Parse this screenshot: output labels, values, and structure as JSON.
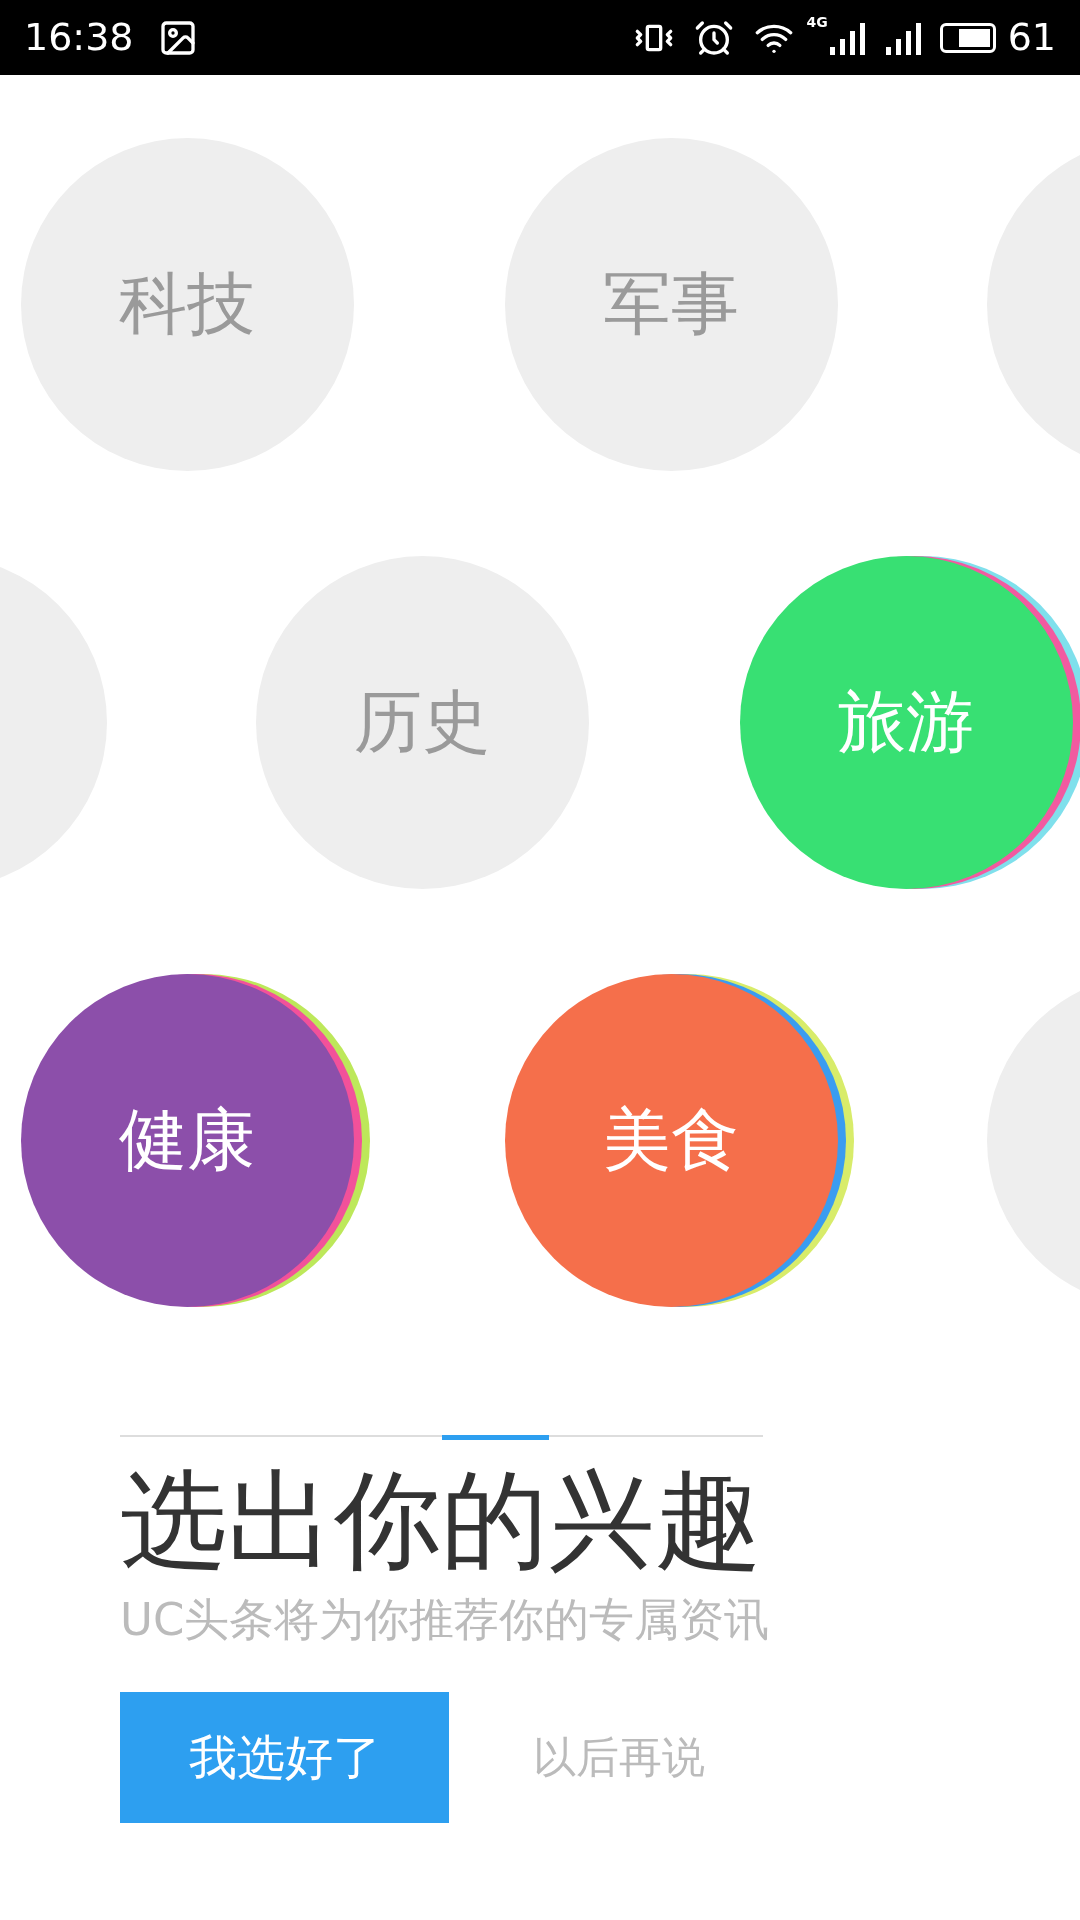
{
  "status_bar": {
    "time": "16:38",
    "network": "4G",
    "battery": "61"
  },
  "topics": [
    {
      "label": "科技",
      "selected": false
    },
    {
      "label": "军事",
      "selected": false
    },
    {
      "label": "历史",
      "selected": false
    },
    {
      "label": "旅游",
      "selected": true,
      "color": "#38e073",
      "rings": [
        {
          "color": "#f25aa0"
        },
        {
          "color": "#7fe0ec"
        }
      ]
    },
    {
      "label": "健康",
      "selected": true,
      "color": "#8c4faa",
      "rings": [
        {
          "color": "#f2519a"
        },
        {
          "color": "#bde85a"
        }
      ]
    },
    {
      "label": "美食",
      "selected": true,
      "color": "#f56f4b",
      "rings": [
        {
          "color": "#3a9cf0"
        },
        {
          "color": "#d8ec6a"
        }
      ]
    }
  ],
  "pager": [
    {
      "selected": false
    },
    {
      "selected": false
    },
    {
      "selected": false
    },
    {
      "selected": true
    },
    {
      "selected": false
    },
    {
      "selected": false
    }
  ],
  "title": "选出你的兴趣",
  "subtitle": "UC头条将为你推荐你的专属资讯",
  "buttons": {
    "confirm": "我选好了",
    "later": "以后再说"
  }
}
